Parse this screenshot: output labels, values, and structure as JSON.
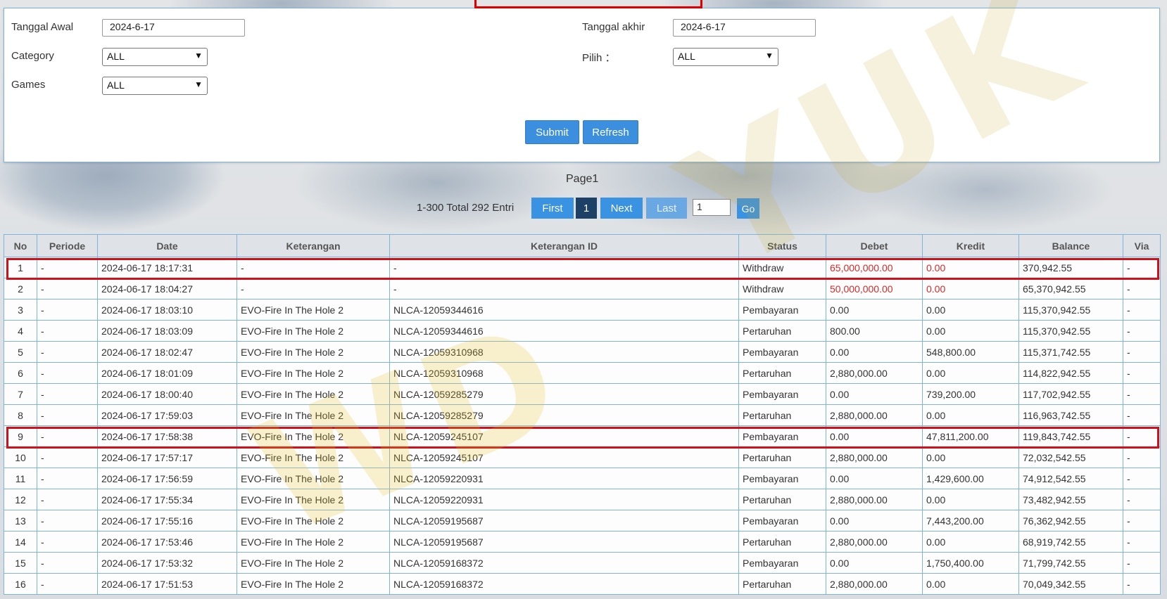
{
  "filters": {
    "start_date_label": "Tanggal Awal",
    "start_date_value": "2024-6-17",
    "end_date_label": "Tanggal akhir",
    "end_date_value": "2024-6-17",
    "category_label": "Category",
    "category_value": "ALL",
    "pilih_label": "Pilih ：",
    "pilih_value": "ALL",
    "games_label": "Games",
    "games_value": "ALL",
    "submit_label": "Submit",
    "refresh_label": "Refresh"
  },
  "pagination": {
    "page_title": "Page1",
    "total_text": "1-300 Total 292 Entri",
    "first_label": "First",
    "current_page": "1",
    "next_label": "Next",
    "last_label": "Last",
    "page_input_value": "1",
    "go_label": "Go"
  },
  "table": {
    "headers": [
      "No",
      "Periode",
      "Date",
      "Keterangan",
      "Keterangan ID",
      "Status",
      "Debet",
      "Kredit",
      "Balance",
      "Via"
    ],
    "rows": [
      [
        "1",
        "-",
        "2024-06-17 18:17:31",
        "-",
        "-",
        "Withdraw",
        "65,000,000.00",
        "0.00",
        "370,942.55",
        "-"
      ],
      [
        "2",
        "-",
        "2024-06-17 18:04:27",
        "-",
        "-",
        "Withdraw",
        "50,000,000.00",
        "0.00",
        "65,370,942.55",
        "-"
      ],
      [
        "3",
        "-",
        "2024-06-17 18:03:10",
        "EVO-Fire In The Hole 2",
        "NLCA-12059344616",
        "Pembayaran",
        "0.00",
        "0.00",
        "115,370,942.55",
        "-"
      ],
      [
        "4",
        "-",
        "2024-06-17 18:03:09",
        "EVO-Fire In The Hole 2",
        "NLCA-12059344616",
        "Pertaruhan",
        "800.00",
        "0.00",
        "115,370,942.55",
        "-"
      ],
      [
        "5",
        "-",
        "2024-06-17 18:02:47",
        "EVO-Fire In The Hole 2",
        "NLCA-12059310968",
        "Pembayaran",
        "0.00",
        "548,800.00",
        "115,371,742.55",
        "-"
      ],
      [
        "6",
        "-",
        "2024-06-17 18:01:09",
        "EVO-Fire In The Hole 2",
        "NLCA-12059310968",
        "Pertaruhan",
        "2,880,000.00",
        "0.00",
        "114,822,942.55",
        "-"
      ],
      [
        "7",
        "-",
        "2024-06-17 18:00:40",
        "EVO-Fire In The Hole 2",
        "NLCA-12059285279",
        "Pembayaran",
        "0.00",
        "739,200.00",
        "117,702,942.55",
        "-"
      ],
      [
        "8",
        "-",
        "2024-06-17 17:59:03",
        "EVO-Fire In The Hole 2",
        "NLCA-12059285279",
        "Pertaruhan",
        "2,880,000.00",
        "0.00",
        "116,963,742.55",
        "-"
      ],
      [
        "9",
        "-",
        "2024-06-17 17:58:38",
        "EVO-Fire In The Hole 2",
        "NLCA-12059245107",
        "Pembayaran",
        "0.00",
        "47,811,200.00",
        "119,843,742.55",
        "-"
      ],
      [
        "10",
        "-",
        "2024-06-17 17:57:17",
        "EVO-Fire In The Hole 2",
        "NLCA-12059245107",
        "Pertaruhan",
        "2,880,000.00",
        "0.00",
        "72,032,542.55",
        "-"
      ],
      [
        "11",
        "-",
        "2024-06-17 17:56:59",
        "EVO-Fire In The Hole 2",
        "NLCA-12059220931",
        "Pembayaran",
        "0.00",
        "1,429,600.00",
        "74,912,542.55",
        "-"
      ],
      [
        "12",
        "-",
        "2024-06-17 17:55:34",
        "EVO-Fire In The Hole 2",
        "NLCA-12059220931",
        "Pertaruhan",
        "2,880,000.00",
        "0.00",
        "73,482,942.55",
        "-"
      ],
      [
        "13",
        "-",
        "2024-06-17 17:55:16",
        "EVO-Fire In The Hole 2",
        "NLCA-12059195687",
        "Pembayaran",
        "0.00",
        "7,443,200.00",
        "76,362,942.55",
        "-"
      ],
      [
        "14",
        "-",
        "2024-06-17 17:53:46",
        "EVO-Fire In The Hole 2",
        "NLCA-12059195687",
        "Pertaruhan",
        "2,880,000.00",
        "0.00",
        "68,919,742.55",
        "-"
      ],
      [
        "15",
        "-",
        "2024-06-17 17:53:32",
        "EVO-Fire In The Hole 2",
        "NLCA-12059168372",
        "Pembayaran",
        "0.00",
        "1,750,400.00",
        "71,799,742.55",
        "-"
      ],
      [
        "16",
        "-",
        "2024-06-17 17:51:53",
        "EVO-Fire In The Hole 2",
        "NLCA-12059168372",
        "Pertaruhan",
        "2,880,000.00",
        "0.00",
        "70,049,342.55",
        "-"
      ]
    ]
  },
  "colors": {
    "primary_button": "#3c8fdf",
    "active_page": "#1d4066",
    "negative_amount": "#d42a2a",
    "highlight_box": "#d0101a",
    "table_border": "#7fb3d9"
  },
  "icons": {
    "select_caret": "chevron-down-icon"
  }
}
